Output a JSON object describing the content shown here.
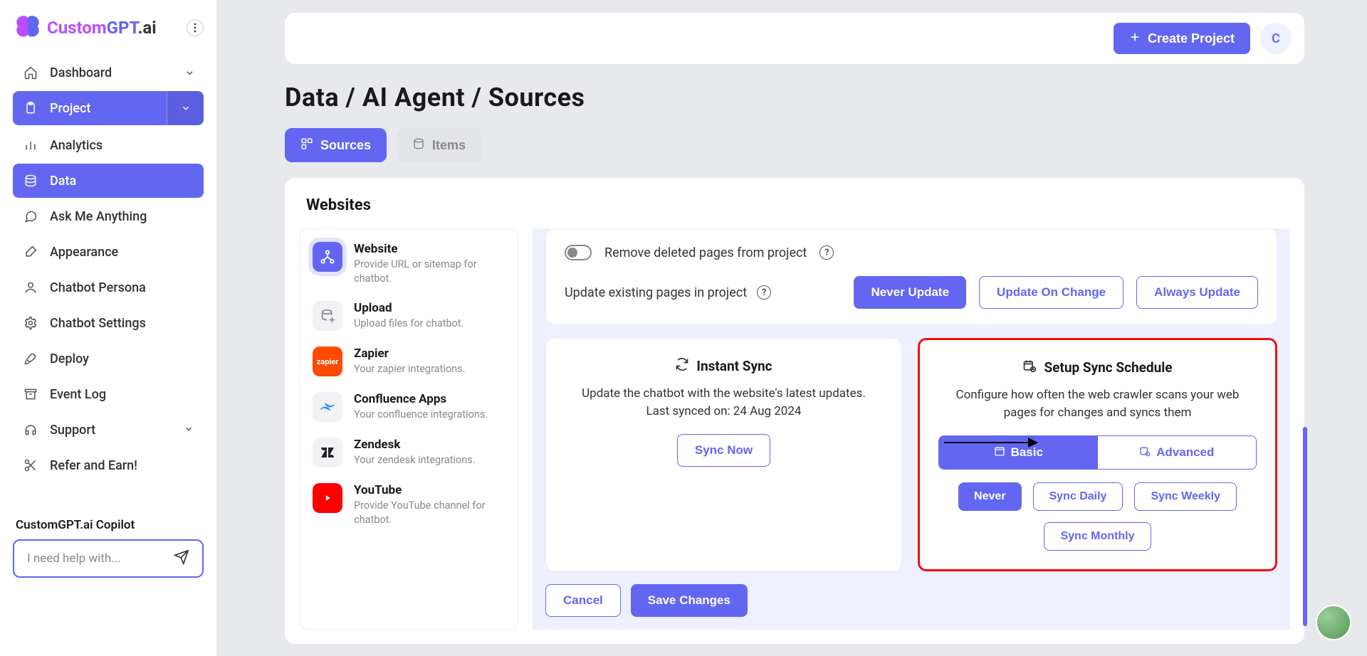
{
  "brand": {
    "custom": "Custom",
    "gpt": "GPT",
    "ai": ".ai"
  },
  "nav": {
    "dashboard": "Dashboard",
    "project": "Project",
    "analytics": "Analytics",
    "data": "Data",
    "ask": "Ask Me Anything",
    "appearance": "Appearance",
    "persona": "Chatbot Persona",
    "settings": "Chatbot Settings",
    "deploy": "Deploy",
    "eventlog": "Event Log",
    "support": "Support",
    "refer": "Refer and Earn!"
  },
  "copilot": {
    "label": "CustomGPT.ai Copilot",
    "placeholder": "I need help with..."
  },
  "header": {
    "createProject": "Create Project",
    "avatar": "C"
  },
  "page": {
    "title": "Data / AI Agent / Sources"
  },
  "tabs": {
    "sources": "Sources",
    "items": "Items"
  },
  "panel": {
    "title": "Websites"
  },
  "sources": [
    {
      "name": "Website",
      "desc": "Provide URL or sitemap for chatbot."
    },
    {
      "name": "Upload",
      "desc": "Upload files for chatbot."
    },
    {
      "name": "Zapier",
      "desc": "Your zapier integrations."
    },
    {
      "name": "Confluence Apps",
      "desc": "Your confluence integrations."
    },
    {
      "name": "Zendesk",
      "desc": "Your zendesk integrations."
    },
    {
      "name": "YouTube",
      "desc": "Provide YouTube channel for chatbot."
    }
  ],
  "settings": {
    "removeDeleted": "Remove deleted pages from project",
    "updateExisting": "Update existing pages in project",
    "neverUpdate": "Never Update",
    "updateOnChange": "Update On Change",
    "alwaysUpdate": "Always Update"
  },
  "instantSync": {
    "title": "Instant Sync",
    "desc1": "Update the chatbot with the website's latest updates.",
    "desc2": "Last synced on: 24 Aug 2024",
    "syncNow": "Sync Now"
  },
  "schedule": {
    "title": "Setup Sync Schedule",
    "desc": "Configure how often the web crawler scans your web pages for changes and syncs them",
    "basic": "Basic",
    "advanced": "Advanced",
    "never": "Never",
    "daily": "Sync Daily",
    "weekly": "Sync Weekly",
    "monthly": "Sync Monthly"
  },
  "actions": {
    "cancel": "Cancel",
    "save": "Save Changes"
  }
}
